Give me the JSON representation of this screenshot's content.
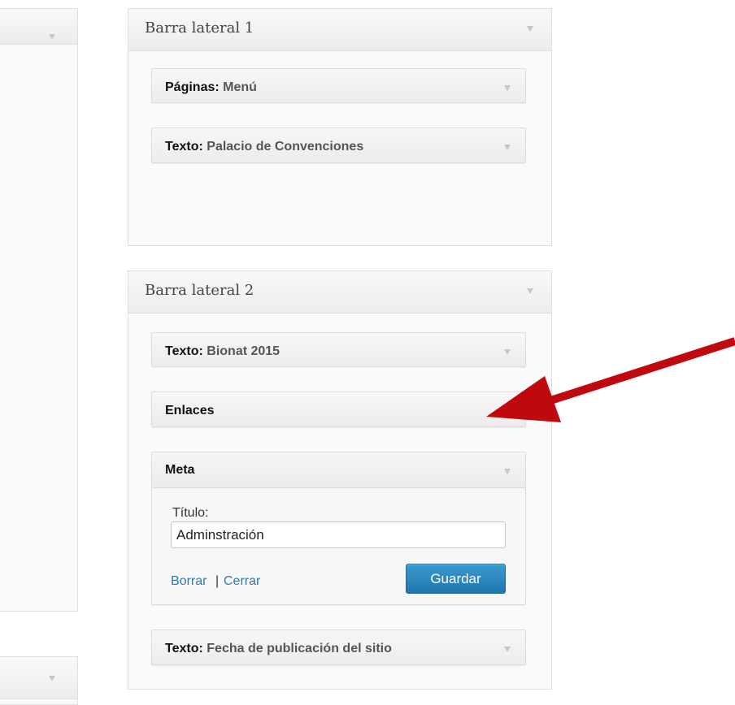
{
  "left_column": {
    "panel_top": {},
    "panel_bottom": {}
  },
  "sidebar1": {
    "title": "Barra lateral 1",
    "widgets": [
      {
        "type": "Páginas:",
        "subtitle": "Menú"
      },
      {
        "type": "Texto:",
        "subtitle": "Palacio de Convenciones"
      }
    ]
  },
  "sidebar2": {
    "title": "Barra lateral 2",
    "widgets": [
      {
        "type": "Texto:",
        "subtitle": "Bionat 2015"
      },
      {
        "type": "Enlaces",
        "subtitle": ""
      },
      {
        "type": "Meta",
        "subtitle": "",
        "field_label": "Título:",
        "field_value": "Adminstración",
        "delete_label": "Borrar",
        "separator": "|",
        "close_label": "Cerrar",
        "save_label": "Guardar"
      },
      {
        "type": "Texto:",
        "subtitle": "Fecha de publicación del sitio"
      }
    ]
  },
  "annotation": {
    "arrow_color": "#c0090f"
  },
  "colors": {
    "accent": "#2a7aaf",
    "button": "#2780b7"
  }
}
